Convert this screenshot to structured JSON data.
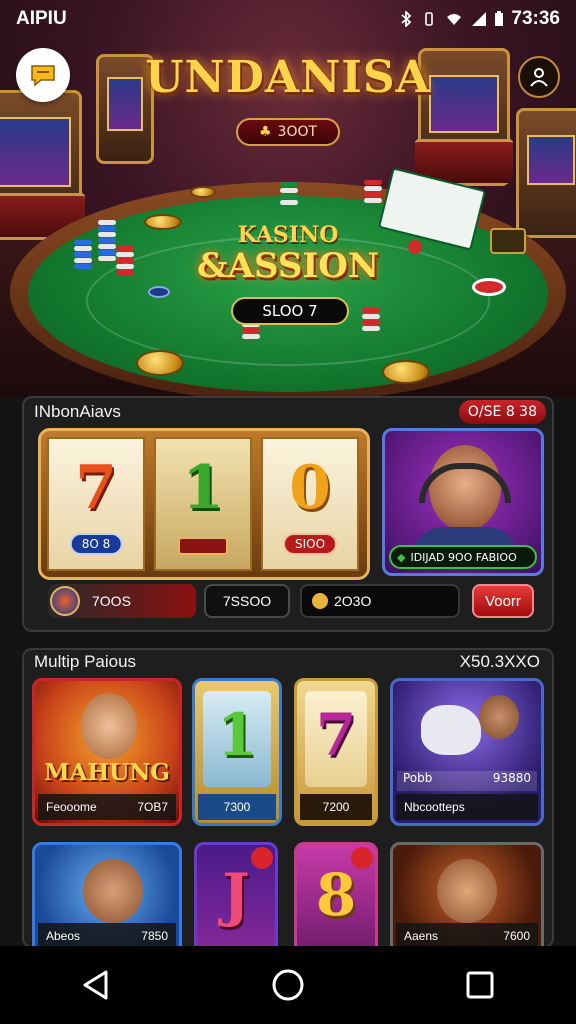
{
  "status_bar": {
    "carrier": "AIPIU",
    "time": "73:36"
  },
  "hero": {
    "title": "UNDANISA",
    "sign_text": "3OOT",
    "casino_kicker": "KASINO",
    "casino_logo": "&ASSION",
    "table_pill": "SLOO 7",
    "chat_icon": "chat-bubble-icon",
    "user_icon": "user-icon"
  },
  "section1": {
    "title": "INbonAiavs",
    "badge": "O/SE 8 38",
    "reels": [
      {
        "symbol": "7",
        "label": "8O 8",
        "color": "#e8521a"
      },
      {
        "symbol": "1",
        "label": "",
        "color": "#3aa82a"
      },
      {
        "symbol": "0",
        "label": "SIOO",
        "color": "#f0a21a"
      }
    ],
    "feature_card": {
      "label": "IDIJAD 9OO FABIOO"
    },
    "controls": {
      "coin_value": "7OOS",
      "bet_value": "7SSOO",
      "balance_value": "2O3O",
      "spin_label": "Voorr"
    }
  },
  "section2": {
    "title": "Multip Paious",
    "value": "X50.3XXO",
    "games": [
      {
        "banner": "MAHUNG",
        "left": "Feooome",
        "right": "7OB7"
      },
      {
        "symbol": "1",
        "left": "",
        "right": "7300"
      },
      {
        "symbol": "7",
        "left": "",
        "right": "7200"
      },
      {
        "top_left": "Pobb",
        "top_right": "93880",
        "left": "Nbcootteps",
        "right": ""
      },
      {
        "left": "Abeos",
        "right": "7850"
      },
      {
        "symbol": "J",
        "left": "",
        "right": ""
      },
      {
        "symbol": "8",
        "left": "",
        "right": ""
      },
      {
        "left": "Aaens",
        "right": "7600"
      }
    ]
  },
  "nav": {
    "back_icon": "back-triangle-icon",
    "home_icon": "home-circle-icon",
    "recents_icon": "recents-square-icon"
  }
}
